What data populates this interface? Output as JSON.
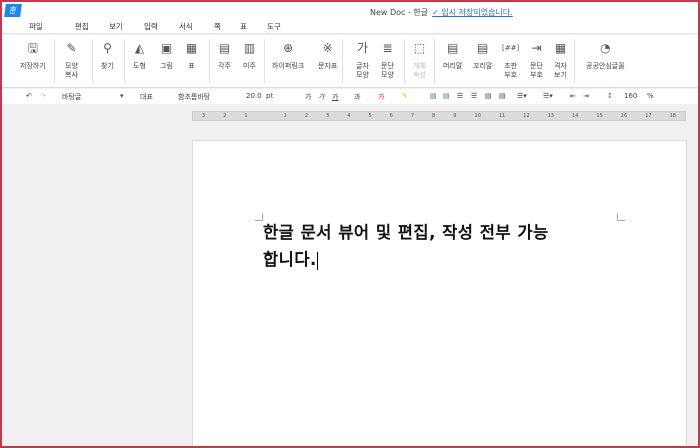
{
  "app": {
    "logo": "훈",
    "title": "New Doc - 한글",
    "status": "✓ 임시 저장되었습니다."
  },
  "menu": [
    "파일",
    "편집",
    "보기",
    "입력",
    "서식",
    "쪽",
    "표",
    "도구"
  ],
  "ribbon": [
    {
      "label": "저장하기",
      "icon": "save-icon",
      "glyph": "🖫"
    },
    {
      "label": "모양\n복사",
      "icon": "format-copy-icon",
      "glyph": "✎"
    },
    {
      "label": "찾기",
      "icon": "binoculars-icon",
      "glyph": "⚲"
    },
    {
      "label": "도형",
      "icon": "shape-icon",
      "glyph": "◭"
    },
    {
      "label": "그림",
      "icon": "picture-icon",
      "glyph": "▣"
    },
    {
      "label": "표",
      "icon": "table-icon",
      "glyph": "▦"
    },
    {
      "label": "각주",
      "icon": "footnote-icon",
      "glyph": "▤"
    },
    {
      "label": "미주",
      "icon": "endnote-icon",
      "glyph": "▥"
    },
    {
      "label": "하이퍼링크",
      "icon": "hyperlink-icon",
      "glyph": "⊕"
    },
    {
      "label": "문자표",
      "icon": "symbol-icon",
      "glyph": "※"
    },
    {
      "label": "글자\n모양",
      "icon": "char-shape-icon",
      "glyph": "가"
    },
    {
      "label": "문단\n모양",
      "icon": "para-shape-icon",
      "glyph": "≣"
    },
    {
      "label": "개체\n속성",
      "icon": "object-props-icon",
      "glyph": "⬚"
    },
    {
      "label": "머리말",
      "icon": "header-icon",
      "glyph": "▤"
    },
    {
      "label": "꼬리말",
      "icon": "footer-icon",
      "glyph": "▤"
    },
    {
      "label": "조판\n부호",
      "icon": "markup-icon",
      "glyph": "[##]"
    },
    {
      "label": "문단\n부호",
      "icon": "para-mark-icon",
      "glyph": "⇥"
    },
    {
      "label": "격자\n보기",
      "icon": "grid-icon",
      "glyph": "▦"
    },
    {
      "label": "공공안심글꼴",
      "icon": "safe-font-icon",
      "glyph": "◔"
    }
  ],
  "toolbar": {
    "style": "바탕글",
    "lang": "대표",
    "font": "함초롬바탕",
    "size": "20.0",
    "unit": "pt",
    "bold": "가",
    "italic": "가",
    "underline": "가",
    "strike": "과",
    "line_spacing": "160",
    "percent": "%"
  },
  "ruler": [
    "3",
    "2",
    "1",
    "",
    "1",
    "2",
    "3",
    "4",
    "5",
    "6",
    "7",
    "8",
    "9",
    "10",
    "11",
    "12",
    "13",
    "14",
    "15",
    "16",
    "17",
    "18"
  ],
  "document": {
    "text": "한글 문서 뷰어 및 편집, 작성 전부 가능합니다."
  }
}
